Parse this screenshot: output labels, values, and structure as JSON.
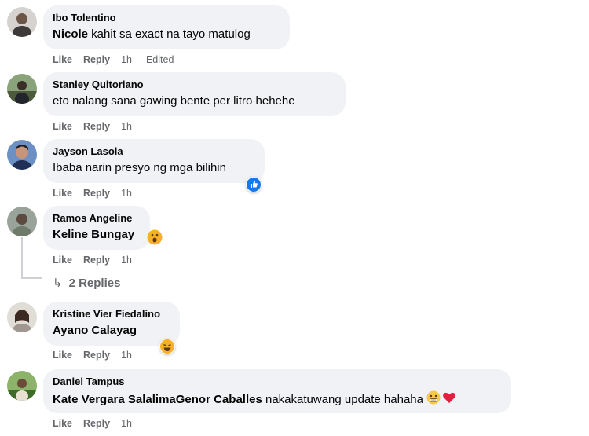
{
  "comments": [
    {
      "author": "Ibo Tolentino",
      "tag": "Nicole",
      "text": " kahit sa exact na tayo matulog",
      "like": "Like",
      "reply": "Reply",
      "time": "1h",
      "edited": "Edited"
    },
    {
      "author": "Stanley Quitoriano",
      "text": "eto nalang sana gawing bente per litro hehehe",
      "like": "Like",
      "reply": "Reply",
      "time": "1h"
    },
    {
      "author": "Jayson Lasola",
      "text": "Ibaba narin presyo ng mga bilihin",
      "like": "Like",
      "reply": "Reply",
      "time": "1h",
      "reaction": "like-reaction-icon"
    },
    {
      "author": "Ramos Angeline",
      "tag": "Keline Bungay",
      "like": "Like",
      "reply": "Reply",
      "time": "1h",
      "emoji": "wow-emoji-icon"
    },
    {
      "author": "Kristine Vier Fiedalino",
      "tag": "Ayano Calayag",
      "like": "Like",
      "reply": "Reply",
      "time": "1h",
      "reaction": "haha-reaction-icon"
    },
    {
      "author": "Daniel Tampus",
      "tag": "Kate Vergara SalalimaGenor Caballes",
      "text": " nakakatuwang update hahaha",
      "like": "Like",
      "reply": "Reply",
      "time": "1h",
      "emojis": [
        "grimace-emoji-icon",
        "heart-emoji-icon"
      ]
    }
  ],
  "replies_link": {
    "arrow": "↳",
    "label": "2 Replies"
  },
  "colors": {
    "bubble": "#f0f2f5",
    "action_text": "#65676b",
    "like_blue": "#1877f2",
    "haha_yellow": "#f7b125",
    "heart_red": "#e41e3f"
  }
}
